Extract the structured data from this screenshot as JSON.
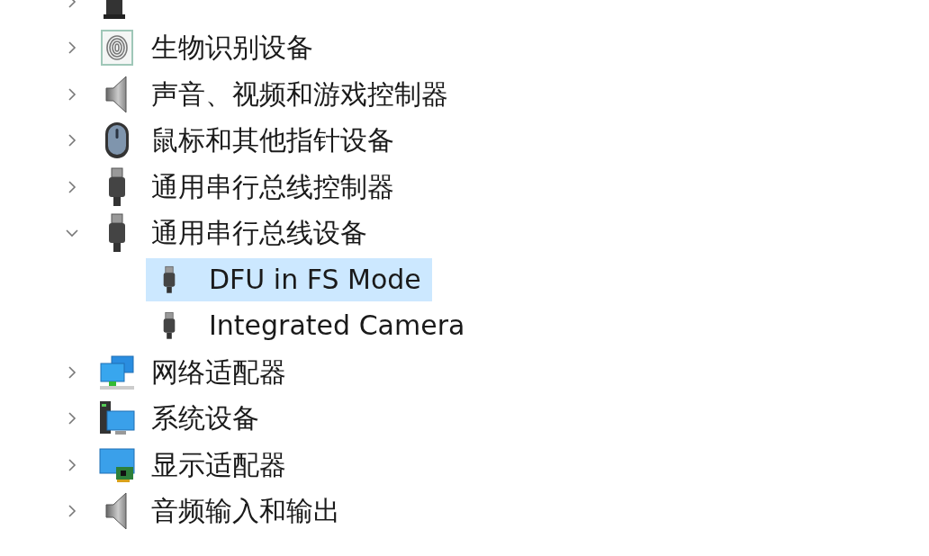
{
  "device_tree": [
    {
      "kind": "software",
      "expanded": false,
      "selected": false
    },
    {
      "kind": "biometric",
      "label": "生物识别设备",
      "expanded": false,
      "selected": false
    },
    {
      "kind": "speaker",
      "label": "声音、视频和游戏控制器",
      "expanded": false,
      "selected": false
    },
    {
      "kind": "mouse",
      "label": "鼠标和其他指针设备",
      "expanded": false,
      "selected": false
    },
    {
      "kind": "usb",
      "label": "通用串行总线控制器",
      "expanded": false,
      "selected": false
    },
    {
      "kind": "usb",
      "label": "通用串行总线设备",
      "expanded": true,
      "selected": false,
      "children": [
        {
          "kind": "usb",
          "label": "DFU in FS Mode",
          "selected": true
        },
        {
          "kind": "usb",
          "label": "Integrated Camera",
          "selected": false
        }
      ]
    },
    {
      "kind": "network",
      "label": "网络适配器",
      "expanded": false,
      "selected": false
    },
    {
      "kind": "system",
      "label": "系统设备",
      "expanded": false,
      "selected": false
    },
    {
      "kind": "display",
      "label": "显示适配器",
      "expanded": false,
      "selected": false
    },
    {
      "kind": "speaker",
      "label": "音频输入和输出",
      "expanded": false,
      "selected": false
    }
  ]
}
